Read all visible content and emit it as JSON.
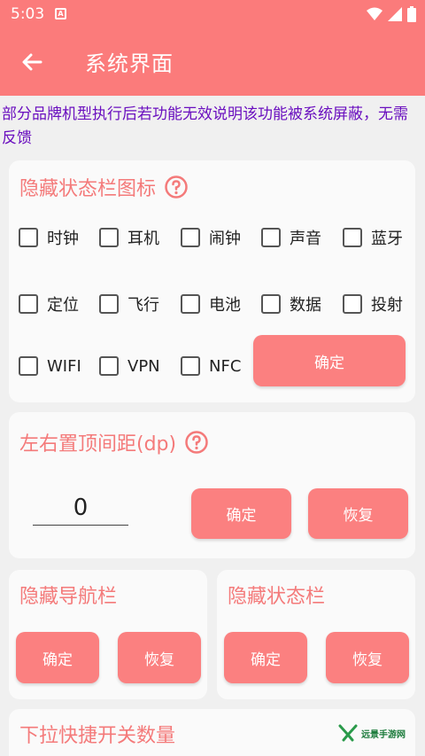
{
  "status_bar": {
    "time": "5:03",
    "notification_icon": "A"
  },
  "app_bar": {
    "title": "系统界面",
    "back_icon": "arrow-left-icon"
  },
  "notice": "部分品牌机型执行后若功能无效说明该功能被系统屏蔽，无需反馈",
  "hide_statusbar_icons": {
    "title": "隐藏状态栏图标",
    "items": [
      "时钟",
      "耳机",
      "闹钟",
      "声音",
      "蓝牙",
      "定位",
      "飞行",
      "电池",
      "数据",
      "投射",
      "WIFI",
      "VPN",
      "NFC"
    ],
    "confirm_label": "确定"
  },
  "padding_card": {
    "title": "左右置顶间距(dp)",
    "value": "0",
    "confirm_label": "确定",
    "restore_label": "恢复"
  },
  "hide_navbar": {
    "title": "隐藏导航栏",
    "confirm_label": "确定",
    "restore_label": "恢复"
  },
  "hide_statusbar": {
    "title": "隐藏状态栏",
    "confirm_label": "确定",
    "restore_label": "恢复"
  },
  "quick_toggle": {
    "title": "下拉快捷开关数量"
  },
  "watermark": {
    "text": "远景手游网"
  },
  "colors": {
    "accent": "#fb7b7b",
    "button": "#fb8080",
    "title_text": "#f47a7a",
    "notice_text": "#6a0fbf"
  }
}
